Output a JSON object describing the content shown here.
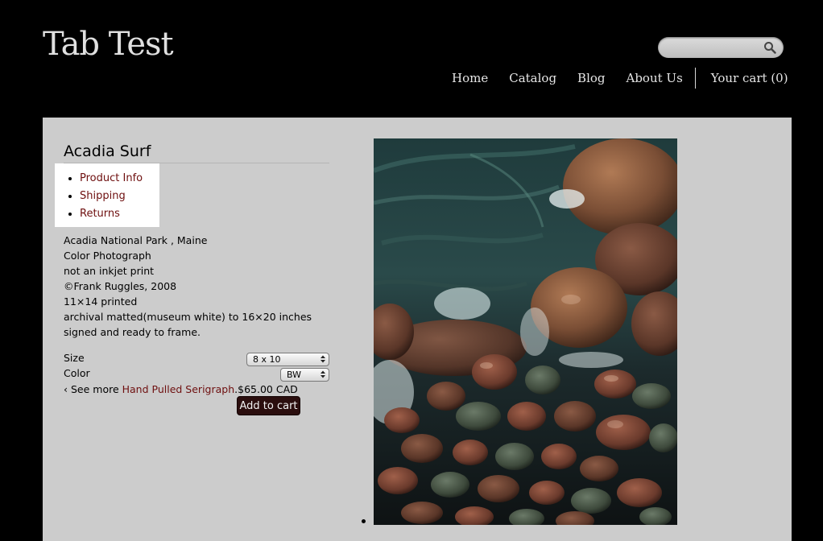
{
  "site": {
    "title": "Tab Test"
  },
  "search": {
    "value": "",
    "placeholder": ""
  },
  "nav": {
    "items": [
      "Home",
      "Catalog",
      "Blog",
      "About Us"
    ],
    "cart": "Your cart (0)"
  },
  "product": {
    "title": "Acadia Surf",
    "tabs": [
      "Product Info",
      "Shipping",
      "Returns"
    ],
    "description": [
      "Acadia National Park , Maine",
      "Color Photograph",
      "not an inkjet print",
      "©Frank Ruggles, 2008",
      "11×14 printed",
      "archival matted(museum white) to 16×20 inches",
      "signed and ready to frame."
    ],
    "options": {
      "size_label": "Size",
      "size_value": "8 x 10",
      "color_label": "Color",
      "color_value": "BW"
    },
    "see_more_prefix": "‹ See more ",
    "see_more_link": "Hand Pulled Serigraph",
    "see_more_suffix": ".",
    "price": "$65.00 CAD",
    "add_to_cart": "Add to cart"
  },
  "colors": {
    "background": "#000000",
    "panel": "#cccccc",
    "link": "#6e0f0f",
    "button": "#2b0e0e"
  },
  "icons": {
    "search": "search-icon",
    "select_arrows": "updown-arrows-icon"
  }
}
